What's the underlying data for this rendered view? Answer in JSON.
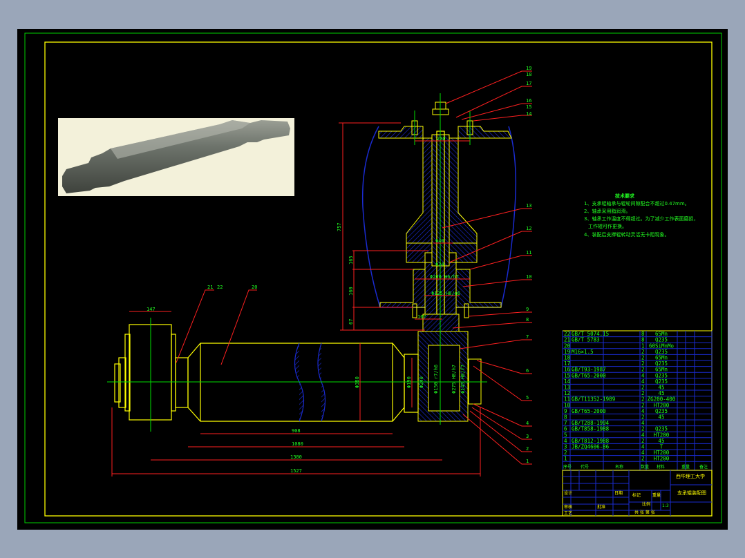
{
  "colors": {
    "background": "#000000",
    "frame": "#ffff00",
    "outer_border": "#00ff00",
    "outline": "#ffff00",
    "hatch": "#0000ff",
    "dimension": "#ff0000",
    "text": "#00ff00",
    "table": "#0000ff"
  },
  "tech_requirements": {
    "title": "技术要求",
    "items": [
      "1、支承辊轴承与辊轮间隙配合不超过0.47mm。",
      "2、轴承采用脂润滑。",
      "3、轴承工作温度不得超过。为了减少工作表面磨损，",
      "工作辊可作更换。",
      "4、装配后支撑辊转动灵活无卡阻现象。"
    ]
  },
  "dimensions": {
    "height_total": "757",
    "h1": "165",
    "h2": "160",
    "h3": "67",
    "d_top": "200",
    "d_mid": "Φ40",
    "d_small": "Φ24",
    "fit1": "Φ200 H6/h7",
    "fit2": "Φ125 H8/g6",
    "d_bolt": "107",
    "w_left": "147",
    "d_roll": "Φ380",
    "d_neck": "Φ190",
    "d_neck2": "Φ240",
    "fit3": "Φ150 r7/h6",
    "fit4": "Φ275 H8/h7",
    "fit5": "Φ145 H8/f7",
    "len1": "908",
    "len2": "1080",
    "len3": "1380",
    "len4": "1527"
  },
  "balloons": {
    "right": [
      "19",
      "18",
      "17",
      "16",
      "15",
      "14",
      "13",
      "12",
      "11",
      "10",
      "9",
      "8",
      "7",
      "6",
      "5",
      "4",
      "3",
      "2",
      "1"
    ],
    "left": [
      "21",
      "22",
      "20"
    ]
  },
  "parts_list": {
    "rows": [
      {
        "no": "22",
        "std": "GB/T 5074.15",
        "qty": "8",
        "material": "65Mn"
      },
      {
        "no": "21",
        "std": "GB/T 5783",
        "qty": "8",
        "material": "Q235"
      },
      {
        "no": "20",
        "std": "",
        "qty": "1",
        "material": "60SiMnMo"
      },
      {
        "no": "19",
        "std": "M16×1.5",
        "qty": "2",
        "material": "Q235"
      },
      {
        "no": "18",
        "std": "",
        "qty": "2",
        "material": "65Mn"
      },
      {
        "no": "17",
        "std": "",
        "qty": "2",
        "material": "Q235"
      },
      {
        "no": "16",
        "std": "GB/T93-1987",
        "qty": "2",
        "material": "65Mn"
      },
      {
        "no": "15",
        "std": "GB/T65-2000",
        "qty": "4",
        "material": "Q235"
      },
      {
        "no": "14",
        "std": "",
        "qty": "4",
        "material": "Q235"
      },
      {
        "no": "13",
        "std": "",
        "qty": "2",
        "material": "45"
      },
      {
        "no": "12",
        "std": "",
        "qty": "2",
        "material": "45"
      },
      {
        "no": "11",
        "std": "GB/T11352-1989",
        "qty": "2",
        "material": "ZG200-400"
      },
      {
        "no": "10",
        "std": "",
        "qty": "2",
        "material": "HT200"
      },
      {
        "no": "9",
        "std": "GB/T65-2000",
        "qty": "4",
        "material": "Q235"
      },
      {
        "no": "8",
        "std": "",
        "qty": "2",
        "material": "45"
      },
      {
        "no": "7",
        "std": "GB/T288-1994",
        "qty": "4",
        "material": ""
      },
      {
        "no": "6",
        "std": "GB/T858-1988",
        "qty": "2",
        "material": "Q235"
      },
      {
        "no": "5",
        "std": "",
        "qty": "4",
        "material": "HT200"
      },
      {
        "no": "4",
        "std": "GB/T812-1988",
        "qty": "2",
        "material": "45"
      },
      {
        "no": "3",
        "std": "JB/ZQ4606-86",
        "qty": "4",
        "material": "T"
      },
      {
        "no": "2",
        "std": "",
        "qty": "4",
        "material": "HT200"
      },
      {
        "no": "1",
        "std": "",
        "qty": "2",
        "material": "HT200"
      }
    ],
    "header": {
      "no": "序号",
      "std": "代号",
      "name": "名称",
      "qty": "数量",
      "material": "材料",
      "unit_weight": "单件",
      "total_weight": "总计",
      "weight": "重量",
      "remark": "备注"
    }
  },
  "title_block": {
    "school": "西华理工大学",
    "drawing_name": "支承辊装配图",
    "scale_label": "比例",
    "scale": "1:3",
    "sheet": "共 张 第 张",
    "mark": "标记",
    "qty_label": "数量",
    "weight_label": "重量",
    "design": "设计",
    "check": "审核",
    "process": "工艺",
    "approve": "批准",
    "date": "日期"
  }
}
